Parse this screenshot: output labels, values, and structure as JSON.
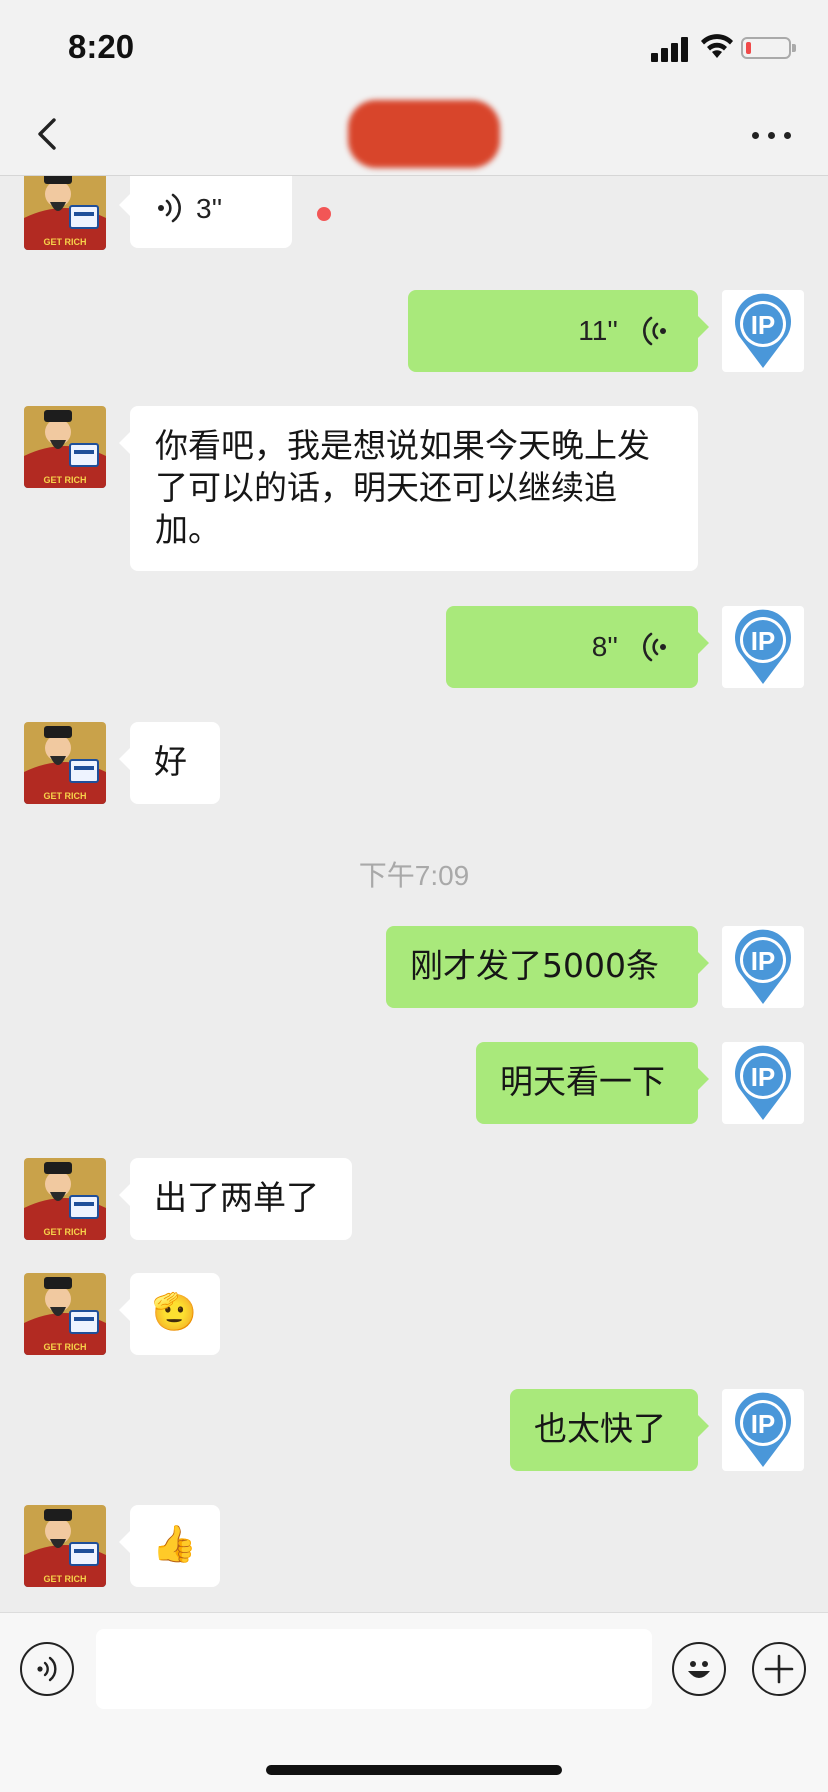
{
  "status_bar": {
    "time": "8:20",
    "battery_level": 0.12
  },
  "nav": {
    "title": ""
  },
  "messages": [
    {
      "side": "left",
      "type": "voice",
      "duration": "3''",
      "unread": true
    },
    {
      "side": "right",
      "type": "voice",
      "duration": "11''"
    },
    {
      "side": "left",
      "type": "text",
      "text": "你看吧，我是想说如果今天晚上发了可以的话，明天还可以继续追加。"
    },
    {
      "side": "right",
      "type": "voice",
      "duration": "8''"
    },
    {
      "side": "left",
      "type": "text",
      "text": "好"
    },
    {
      "type": "time",
      "text": "下午7:09"
    },
    {
      "side": "right",
      "type": "text",
      "text": "刚才发了5000条"
    },
    {
      "side": "right",
      "type": "text",
      "text": "明天看一下"
    },
    {
      "side": "left",
      "type": "text",
      "text": "出了两单了"
    },
    {
      "side": "left",
      "type": "emoji",
      "text": "🫡"
    },
    {
      "side": "right",
      "type": "text",
      "text": "也太快了"
    },
    {
      "side": "left",
      "type": "emoji",
      "text": "👍"
    }
  ],
  "input": {
    "value": "",
    "placeholder": ""
  },
  "icons": {
    "back": "chevron-left-icon",
    "more": "more-dots-icon",
    "voice": "voice-icon",
    "emoji": "smiley-icon",
    "add": "plus-icon"
  },
  "colors": {
    "sent_bubble": "#a9e97b",
    "received_bubble": "#ffffff",
    "background": "#ededed",
    "unread": "#f25656"
  }
}
